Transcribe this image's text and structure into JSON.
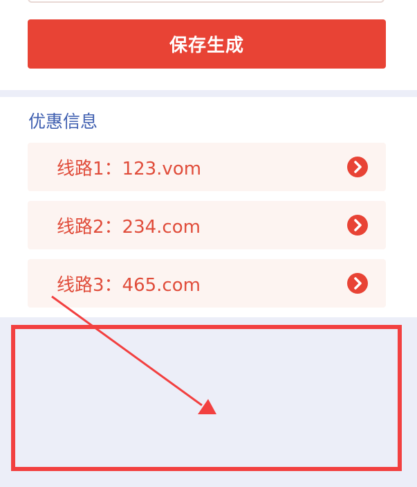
{
  "save_button": {
    "label": "保存生成"
  },
  "promo": {
    "title": "优惠信息",
    "routes": [
      {
        "label": "线路1：123.vom"
      },
      {
        "label": "线路2：234.com"
      },
      {
        "label": "线路3：465.com"
      }
    ]
  },
  "icons": {
    "route_arrow": "chevron-right-circle-icon"
  },
  "colors": {
    "primary": "#e84335",
    "title": "#3f5fb0",
    "route_text": "#e04c3a",
    "route_bg": "#fdf4f1",
    "annotation": "#f24040",
    "page_bg": "#eceef8"
  }
}
